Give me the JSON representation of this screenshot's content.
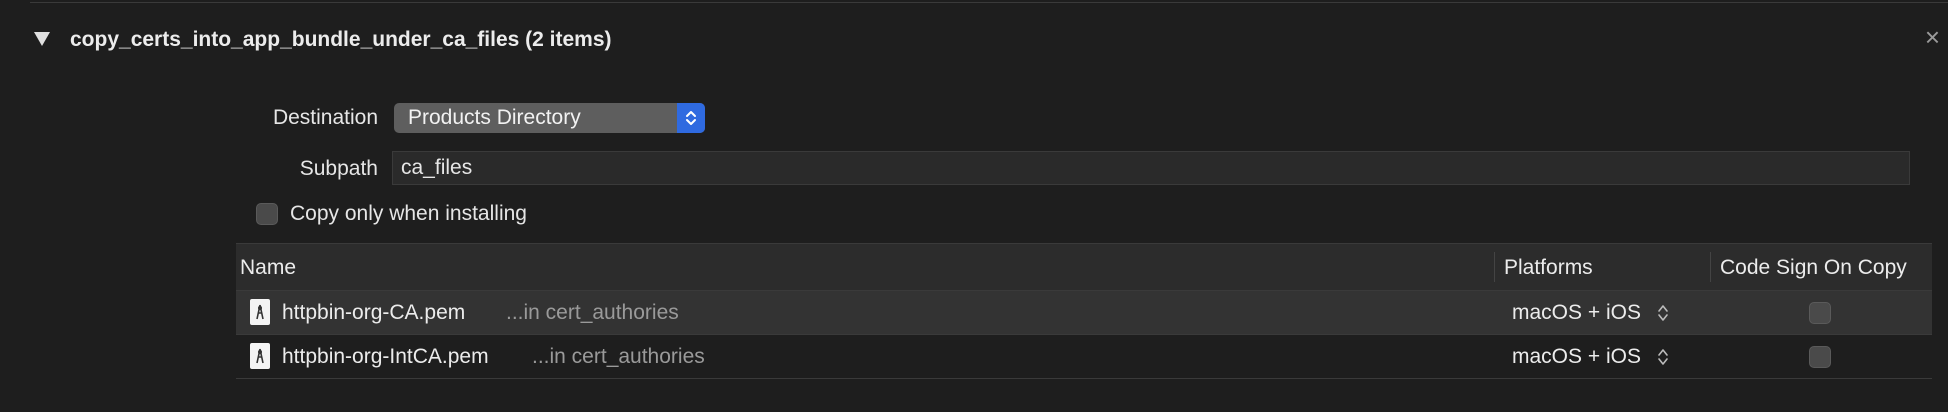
{
  "phase": {
    "title": "copy_certs_into_app_bundle_under_ca_files (2 items)",
    "close_glyph": "×"
  },
  "destination": {
    "label": "Destination",
    "value": "Products Directory"
  },
  "subpath": {
    "label": "Subpath",
    "value": "ca_files"
  },
  "copy_only_installing": {
    "label": "Copy only when installing",
    "checked": false
  },
  "table": {
    "headers": {
      "name": "Name",
      "platforms": "Platforms",
      "code_sign": "Code Sign On Copy"
    },
    "rows": [
      {
        "name": "httpbin-org-CA.pem",
        "location": "...in cert_authories",
        "platforms": "macOS + iOS",
        "code_sign": false,
        "icon": "certificate-file-icon"
      },
      {
        "name": "httpbin-org-IntCA.pem",
        "location": "...in cert_authories",
        "platforms": "macOS + iOS",
        "code_sign": false,
        "icon": "certificate-file-icon"
      }
    ]
  },
  "colors": {
    "background": "#1e1e1e",
    "accent": "#2f6ae0",
    "selected_row": "#333333"
  }
}
